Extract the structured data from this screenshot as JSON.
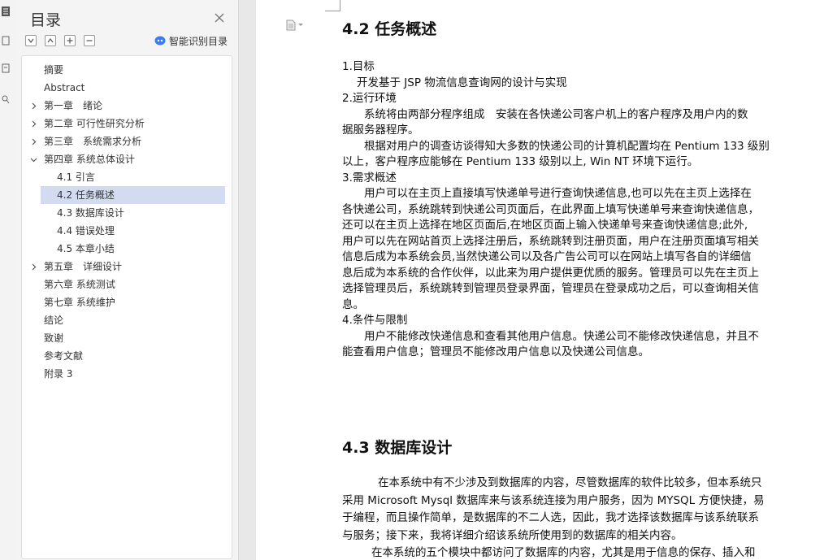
{
  "nav": {
    "title": "目录",
    "smart_label": "智能识别目录",
    "items": [
      {
        "label": "摘要",
        "level": 0,
        "caret": "none",
        "active": false
      },
      {
        "label": "Abstract",
        "level": 0,
        "caret": "none",
        "active": false
      },
      {
        "label": "第一章　绪论",
        "level": 0,
        "caret": "right",
        "active": false
      },
      {
        "label": "第二章  可行性研究分析",
        "level": 0,
        "caret": "right",
        "active": false
      },
      {
        "label": "第三章　系统需求分析",
        "level": 0,
        "caret": "right",
        "active": false
      },
      {
        "label": "第四章  系统总体设计",
        "level": 0,
        "caret": "down",
        "active": false
      },
      {
        "label": "4.1 引言",
        "level": 1,
        "caret": "none",
        "active": false
      },
      {
        "label": "4.2 任务概述",
        "level": 1,
        "caret": "none",
        "active": true
      },
      {
        "label": "4.3 数据库设计",
        "level": 1,
        "caret": "none",
        "active": false
      },
      {
        "label": "4.4 错误处理",
        "level": 1,
        "caret": "none",
        "active": false
      },
      {
        "label": "4.5 本章小结",
        "level": 1,
        "caret": "none",
        "active": false
      },
      {
        "label": "第五章　详细设计",
        "level": 0,
        "caret": "right",
        "active": false
      },
      {
        "label": "第六章  系统测试",
        "level": 0,
        "caret": "none",
        "active": false
      },
      {
        "label": "第七章  系统维护",
        "level": 0,
        "caret": "none",
        "active": false
      },
      {
        "label": "结论",
        "level": 0,
        "caret": "none",
        "active": false
      },
      {
        "label": "致谢",
        "level": 0,
        "caret": "none",
        "active": false
      },
      {
        "label": "参考文献",
        "level": 0,
        "caret": "none",
        "active": false
      },
      {
        "label": "附录 3",
        "level": 0,
        "caret": "none",
        "active": false
      }
    ]
  },
  "doc": {
    "heading_42": "4.2 任务概述",
    "heading_43": "4.3 数据库设计",
    "lines": [
      {
        "text": "1.目标",
        "indent": "none"
      },
      {
        "text": "开发基于 JSP 物流信息查询网的设计与实现",
        "indent": "small"
      },
      {
        "text": "2.运行环境",
        "indent": "none"
      },
      {
        "text": "系统将由两部分程序组成　安装在各快递公司客户机上的客户程序及用户内的数",
        "indent": "para"
      },
      {
        "text": "据服务器程序。",
        "indent": "none"
      },
      {
        "text": "根据对用户的调查访谈得知大多数的快递公司的计算机配置均在 Pentium 133 级别",
        "indent": "para"
      },
      {
        "text": "以上，客户程序应能够在 Pentium 133 级别以上, Win NT 环境下运行。",
        "indent": "none"
      },
      {
        "text": "3.需求概述",
        "indent": "none"
      },
      {
        "text": "用户可以在主页上直接填写快递单号进行查询快递信息,也可以先在主页上选择在",
        "indent": "para"
      },
      {
        "text": "各快递公司，系统跳转到快递公司页面后，在此界面上填写快递单号来查询快递信息，",
        "indent": "none"
      },
      {
        "text": "还可以在主页上选择在地区页面后,在地区页面上输入快递单号来查询快递信息;此外,",
        "indent": "none"
      },
      {
        "text": "用户可以先在网站首页上选择注册后，系统跳转到注册页面，用户在注册页面填写相关",
        "indent": "none"
      },
      {
        "text": "信息后成为本系统会员,当然快递公司以及各广告公司可以在网站上填写各自的详细信",
        "indent": "none"
      },
      {
        "text": "息后成为本系统的合作伙伴，以此来为用户提供更优质的服务。管理员可以先在主页上",
        "indent": "none"
      },
      {
        "text": "选择管理员后，系统跳转到管理员登录界面，管理员在登录成功之后，可以查询相关信",
        "indent": "none"
      },
      {
        "text": "息。",
        "indent": "none"
      },
      {
        "text": "4.条件与限制",
        "indent": "none"
      },
      {
        "text": "用户不能修改快递信息和查看其他用户信息。快递公司不能修改快递信息，并且不",
        "indent": "para"
      },
      {
        "text": "能查看用户信息；管理员不能修改用户信息以及快递公司信息。",
        "indent": "none"
      }
    ],
    "lines_43": [
      {
        "text": "在本系统中有不少涉及到数据库的内容，尽管数据库的软件比较多，但本系统只",
        "indent": "para"
      },
      {
        "text": "采用 Microsoft Mysql 数据库来与该系统连接为用户服务，因为 MYSQL 方便快捷，易",
        "indent": "none"
      },
      {
        "text": "于编程，而且操作简单，是数据库的不二人选，因此，我才选择该数据库与该系统联系",
        "indent": "none"
      },
      {
        "text": "与服务；接下来，我将详细介绍该系统所使用到的数据库的相关内容。",
        "indent": "none"
      },
      {
        "text": "在本系统的五个模块中都访问了数据库的内容，尤其是用于信息的保存、插入和",
        "indent": "para"
      }
    ]
  }
}
